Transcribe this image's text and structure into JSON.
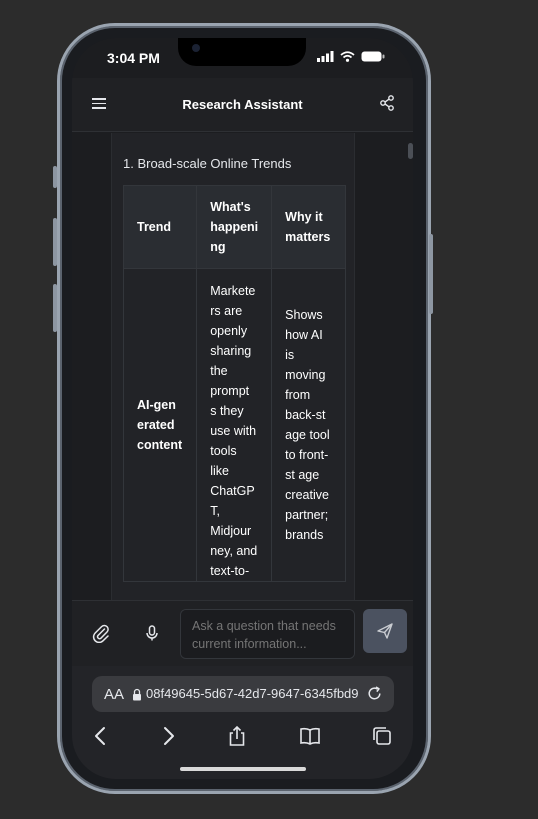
{
  "status_bar": {
    "time": "3:04 PM"
  },
  "header": {
    "title": "Research Assistant",
    "menu_icon": "hamburger-menu-icon",
    "share_icon": "share-icon"
  },
  "message": {
    "section_heading": "1. Broad-scale Online Trends",
    "table": {
      "headers": [
        "Trend",
        "What's happeni ng",
        "Why it matters"
      ],
      "rows": [
        {
          "trend": "AI-gen erated content",
          "whats_happening": "Markete rs are openly sharing the prompt s they use with tools like ChatGP T, Midjour ney, and text-to-",
          "why_it_matters": "Shows how AI is moving from back-st age tool to front-st age creative partner; brands"
        }
      ]
    }
  },
  "composer": {
    "placeholder": "Ask a question that needs current information...",
    "attach_icon": "paperclip-icon",
    "mic_icon": "microphone-icon",
    "send_icon": "send-icon"
  },
  "browser": {
    "text_size_label": "AA",
    "url": "08f49645-5d67-42d7-9647-6345fbd9",
    "icons": [
      "back-icon",
      "forward-icon",
      "share-icon",
      "bookmarks-icon",
      "tabs-icon"
    ]
  },
  "colors": {
    "background": "#2c2c2c",
    "screen": "#1c1d20",
    "header": "#202124",
    "send_button": "#4b5260",
    "text": "#ffffff"
  }
}
